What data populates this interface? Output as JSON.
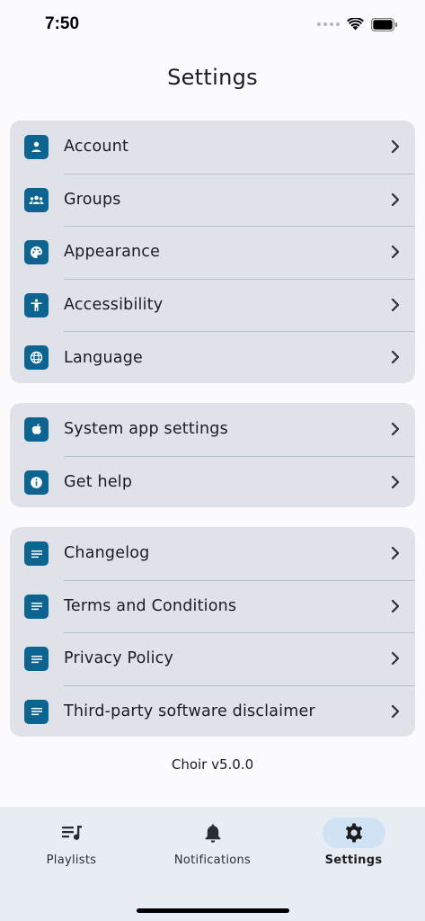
{
  "status_bar": {
    "time": "7:50",
    "icons": [
      "signal-dots-icon",
      "wifi-icon",
      "battery-icon"
    ]
  },
  "header": {
    "title": "Settings"
  },
  "colors": {
    "accent": "#0d6490",
    "group_background": "#dfe3e9",
    "tab_bar_background": "#e8edf3",
    "active_tab_pill": "#cfe3f5"
  },
  "groups": [
    {
      "items": [
        {
          "label": "Account",
          "icon": "person-icon"
        },
        {
          "label": "Groups",
          "icon": "group-icon"
        },
        {
          "label": "Appearance",
          "icon": "palette-icon"
        },
        {
          "label": "Accessibility",
          "icon": "accessibility-icon"
        },
        {
          "label": "Language",
          "icon": "globe-icon"
        }
      ]
    },
    {
      "items": [
        {
          "label": "System app settings",
          "icon": "apple-icon"
        },
        {
          "label": "Get help",
          "icon": "info-icon"
        }
      ]
    },
    {
      "items": [
        {
          "label": "Changelog",
          "icon": "document-lines-icon"
        },
        {
          "label": "Terms and Conditions",
          "icon": "document-lines-icon"
        },
        {
          "label": "Privacy Policy",
          "icon": "document-lines-icon"
        },
        {
          "label": "Third-party software disclaimer",
          "icon": "document-lines-icon"
        }
      ]
    }
  ],
  "footer": {
    "version": "Choir v5.0.0"
  },
  "tab_bar": {
    "tabs": [
      {
        "label": "Playlists",
        "icon": "playlist-icon",
        "active": false
      },
      {
        "label": "Notifications",
        "icon": "bell-icon",
        "active": false
      },
      {
        "label": "Settings",
        "icon": "gear-icon",
        "active": true
      }
    ]
  }
}
